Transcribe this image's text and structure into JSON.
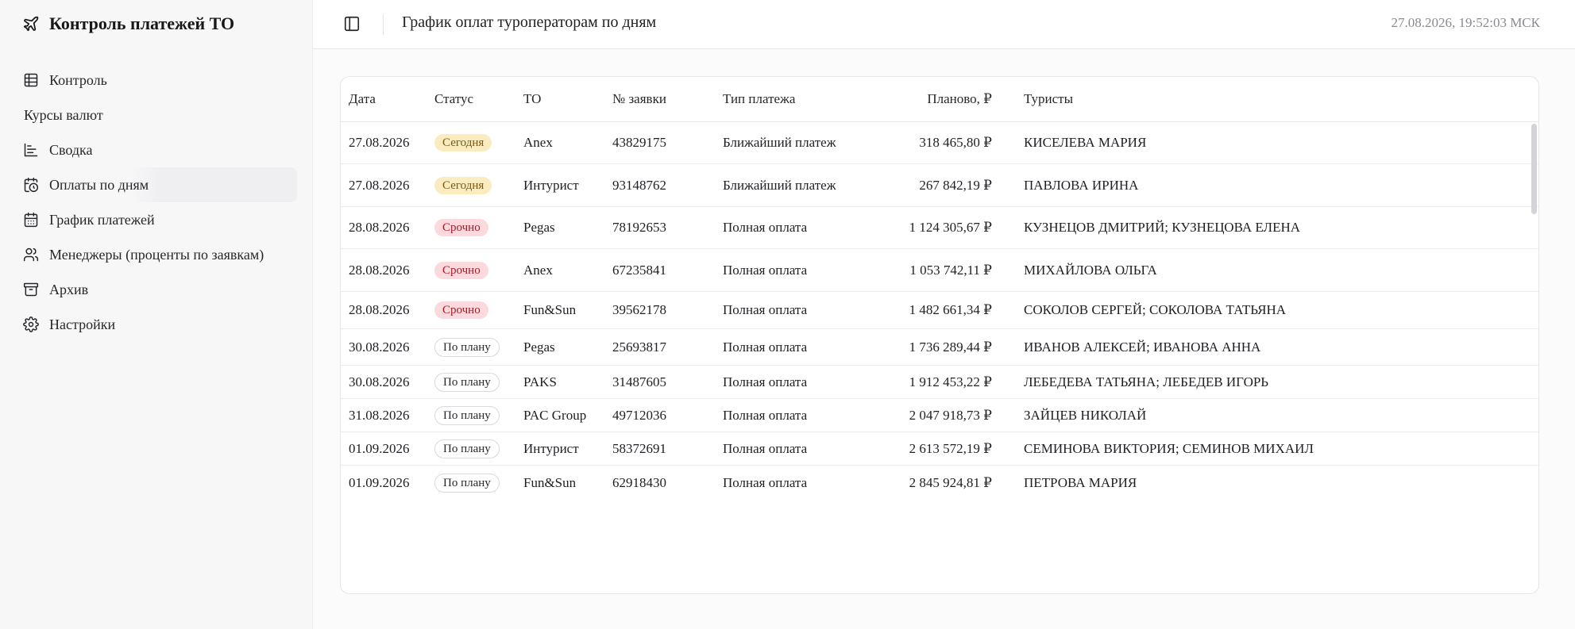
{
  "sidebar": {
    "brand_title": "Контроль платежей ТО",
    "items": [
      {
        "label": "Контроль",
        "icon": "table-icon"
      },
      {
        "label": "Курсы валют",
        "icon": ""
      },
      {
        "label": "Сводка",
        "icon": "chart-icon"
      },
      {
        "label": "Оплаты по дням",
        "icon": "calendar-clock-icon"
      },
      {
        "label": "График платежей",
        "icon": "calendar-icon"
      },
      {
        "label": "Менеджеры (проценты по заявкам)",
        "icon": "users-icon"
      },
      {
        "label": "Архив",
        "icon": "archive-icon"
      },
      {
        "label": "Настройки",
        "icon": "gear-icon"
      }
    ]
  },
  "header": {
    "title": "График оплат туроператорам по дням",
    "datetime": "27.08.2026, 19:52:03 МСК"
  },
  "table": {
    "columns": [
      "Дата",
      "Статус",
      "ТО",
      "№ заявки",
      "Тип платежа",
      "Планово, ₽",
      "Туристы"
    ],
    "rows": [
      {
        "date": "27.08.2026",
        "status": "Сегодня",
        "status_kind": "today",
        "to": "Anex",
        "number": "43829175",
        "type": "Ближайший платеж",
        "amount": "318 465,80 ₽",
        "tourists": "КИСЕЛЕВА МАРИЯ"
      },
      {
        "date": "27.08.2026",
        "status": "Сегодня",
        "status_kind": "today",
        "to": "Интурист",
        "number": "93148762",
        "type": "Ближайший платеж",
        "amount": "267 842,19 ₽",
        "tourists": "ПАВЛОВА ИРИНА"
      },
      {
        "date": "28.08.2026",
        "status": "Срочно",
        "status_kind": "urgent",
        "to": "Pegas",
        "number": "78192653",
        "type": "Полная оплата",
        "amount": "1 124 305,67 ₽",
        "tourists": "КУЗНЕЦОВ ДМИТРИЙ; КУЗНЕЦОВА ЕЛЕНА"
      },
      {
        "date": "28.08.2026",
        "status": "Срочно",
        "status_kind": "urgent",
        "to": "Anex",
        "number": "67235841",
        "type": "Полная оплата",
        "amount": "1 053 742,11 ₽",
        "tourists": "МИХАЙЛОВА ОЛЬГА"
      },
      {
        "date": "28.08.2026",
        "status": "Срочно",
        "status_kind": "urgent",
        "to": "Fun&Sun",
        "number": "39562178",
        "type": "Полная оплата",
        "amount": "1 482 661,34 ₽",
        "tourists": "СОКОЛОВ СЕРГЕЙ; СОКОЛОВА ТАТЬЯНА"
      },
      {
        "date": "30.08.2026",
        "status": "По плану",
        "status_kind": "plan",
        "to": "Pegas",
        "number": "25693817",
        "type": "Полная оплата",
        "amount": "1 736 289,44 ₽",
        "tourists": "ИВАНОВ АЛЕКСЕЙ; ИВАНОВА АННА"
      },
      {
        "date": "30.08.2026",
        "status": "По плану",
        "status_kind": "plan",
        "to": "PAKS",
        "number": "31487605",
        "type": "Полная оплата",
        "amount": "1 912 453,22 ₽",
        "tourists": "ЛЕБЕДЕВА ТАТЬЯНА; ЛЕБЕДЕВ ИГОРЬ"
      },
      {
        "date": "31.08.2026",
        "status": "По плану",
        "status_kind": "plan",
        "to": "PAC Group",
        "number": "49712036",
        "type": "Полная оплата",
        "amount": "2 047 918,73 ₽",
        "tourists": "ЗАЙЦЕВ НИКОЛАЙ"
      },
      {
        "date": "01.09.2026",
        "status": "По плану",
        "status_kind": "plan",
        "to": "Интурист",
        "number": "58372691",
        "type": "Полная оплата",
        "amount": "2 613 572,19 ₽",
        "tourists": "СЕМИНОВА ВИКТОРИЯ; СЕМИНОВ МИХАИЛ"
      },
      {
        "date": "01.09.2026",
        "status": "По плану",
        "status_kind": "plan",
        "to": "Fun&Sun",
        "number": "62918430",
        "type": "Полная оплата",
        "amount": "2 845 924,81 ₽",
        "tourists": "ПЕТРОВА МАРИЯ"
      }
    ]
  },
  "colors": {
    "today_badge": "#fbecc0",
    "urgent_badge": "#fbd9dc",
    "plan_badge_border": "#d9d9de"
  }
}
